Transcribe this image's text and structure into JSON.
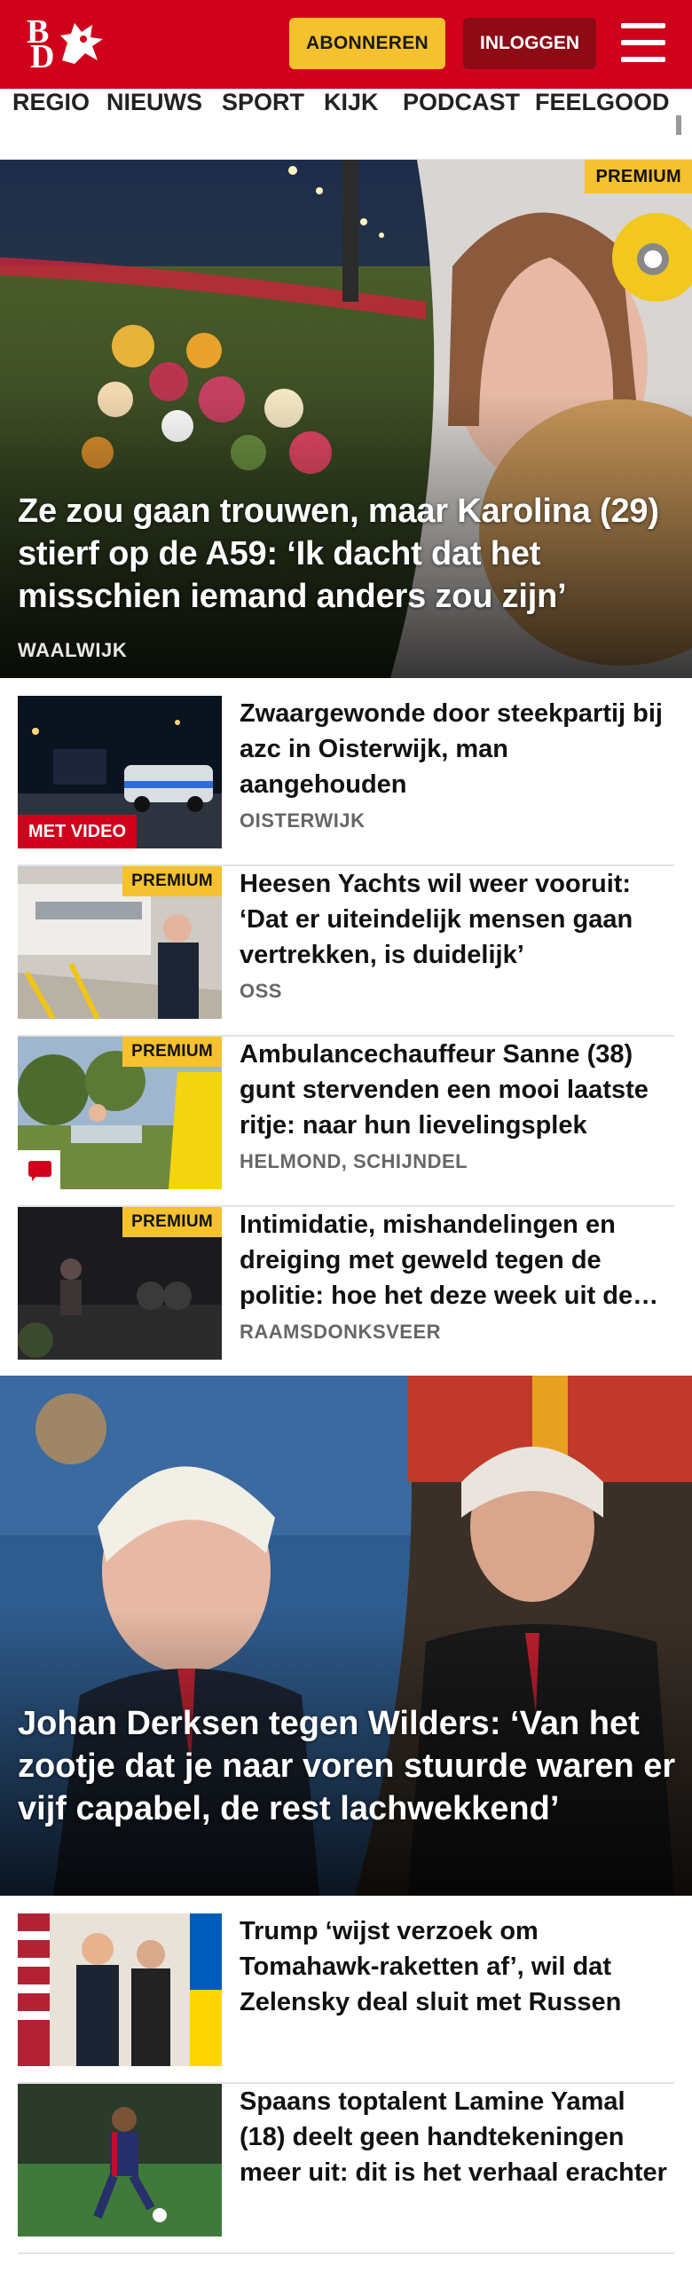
{
  "header": {
    "logo_letters": [
      "B",
      "D"
    ],
    "subscribe_label": "ABONNEREN",
    "login_label": "INLOGGEN",
    "brand_color": "#d0021b",
    "accent_color": "#f5c12e"
  },
  "nav": {
    "items": [
      "REGIO",
      "NIEUWS",
      "SPORT",
      "KIJK",
      "PODCAST",
      "FEELGOOD"
    ]
  },
  "hero": {
    "badge": "PREMIUM",
    "title": "Ze zou gaan trouwen, maar Karolina (29) stierf op de A59: ‘Ik dacht dat het misschien iemand anders zou zijn’",
    "location": "WAALWIJK"
  },
  "articles": [
    {
      "title": "Zwaargewonde door steekpartij bij azc in Oisterwijk, man aangehouden",
      "location": "OISTERWIJK",
      "video_label": "MET VIDEO"
    },
    {
      "title": "Heesen Yachts wil weer vooruit: ‘Dat er uiteindelijk mensen gaan vertrekken, is duidelijk’",
      "location": "OSS",
      "badge": "PREMIUM"
    },
    {
      "title": "Ambulancechauffeur Sanne (38) gunt stervenden een mooi laatste ritje: naar hun lievelingsplek",
      "location": "HELMOND, SCHIJNDEL",
      "badge": "PREMIUM"
    },
    {
      "title": "Intimidatie, mishandelingen en dreiging met geweld tegen de politie: hoe het deze week uit de hand liep",
      "location": "RAAMSDONKSVEER",
      "badge": "PREMIUM"
    }
  ],
  "hero2": {
    "title": "Johan Derksen tegen Wilders: ‘Van het zootje dat je naar voren stuurde waren er vijf capabel, de rest lachwek­kend’"
  },
  "articles2": [
    {
      "title": "Trump ‘wijst verzoek om Tomahawk-raketten af’, wil dat Zelensky deal sluit met Russen"
    },
    {
      "title": "Spaans toptalent Lamine Yamal (18) deelt geen handtekeningen meer uit: dit is het verhaal erachter"
    }
  ]
}
